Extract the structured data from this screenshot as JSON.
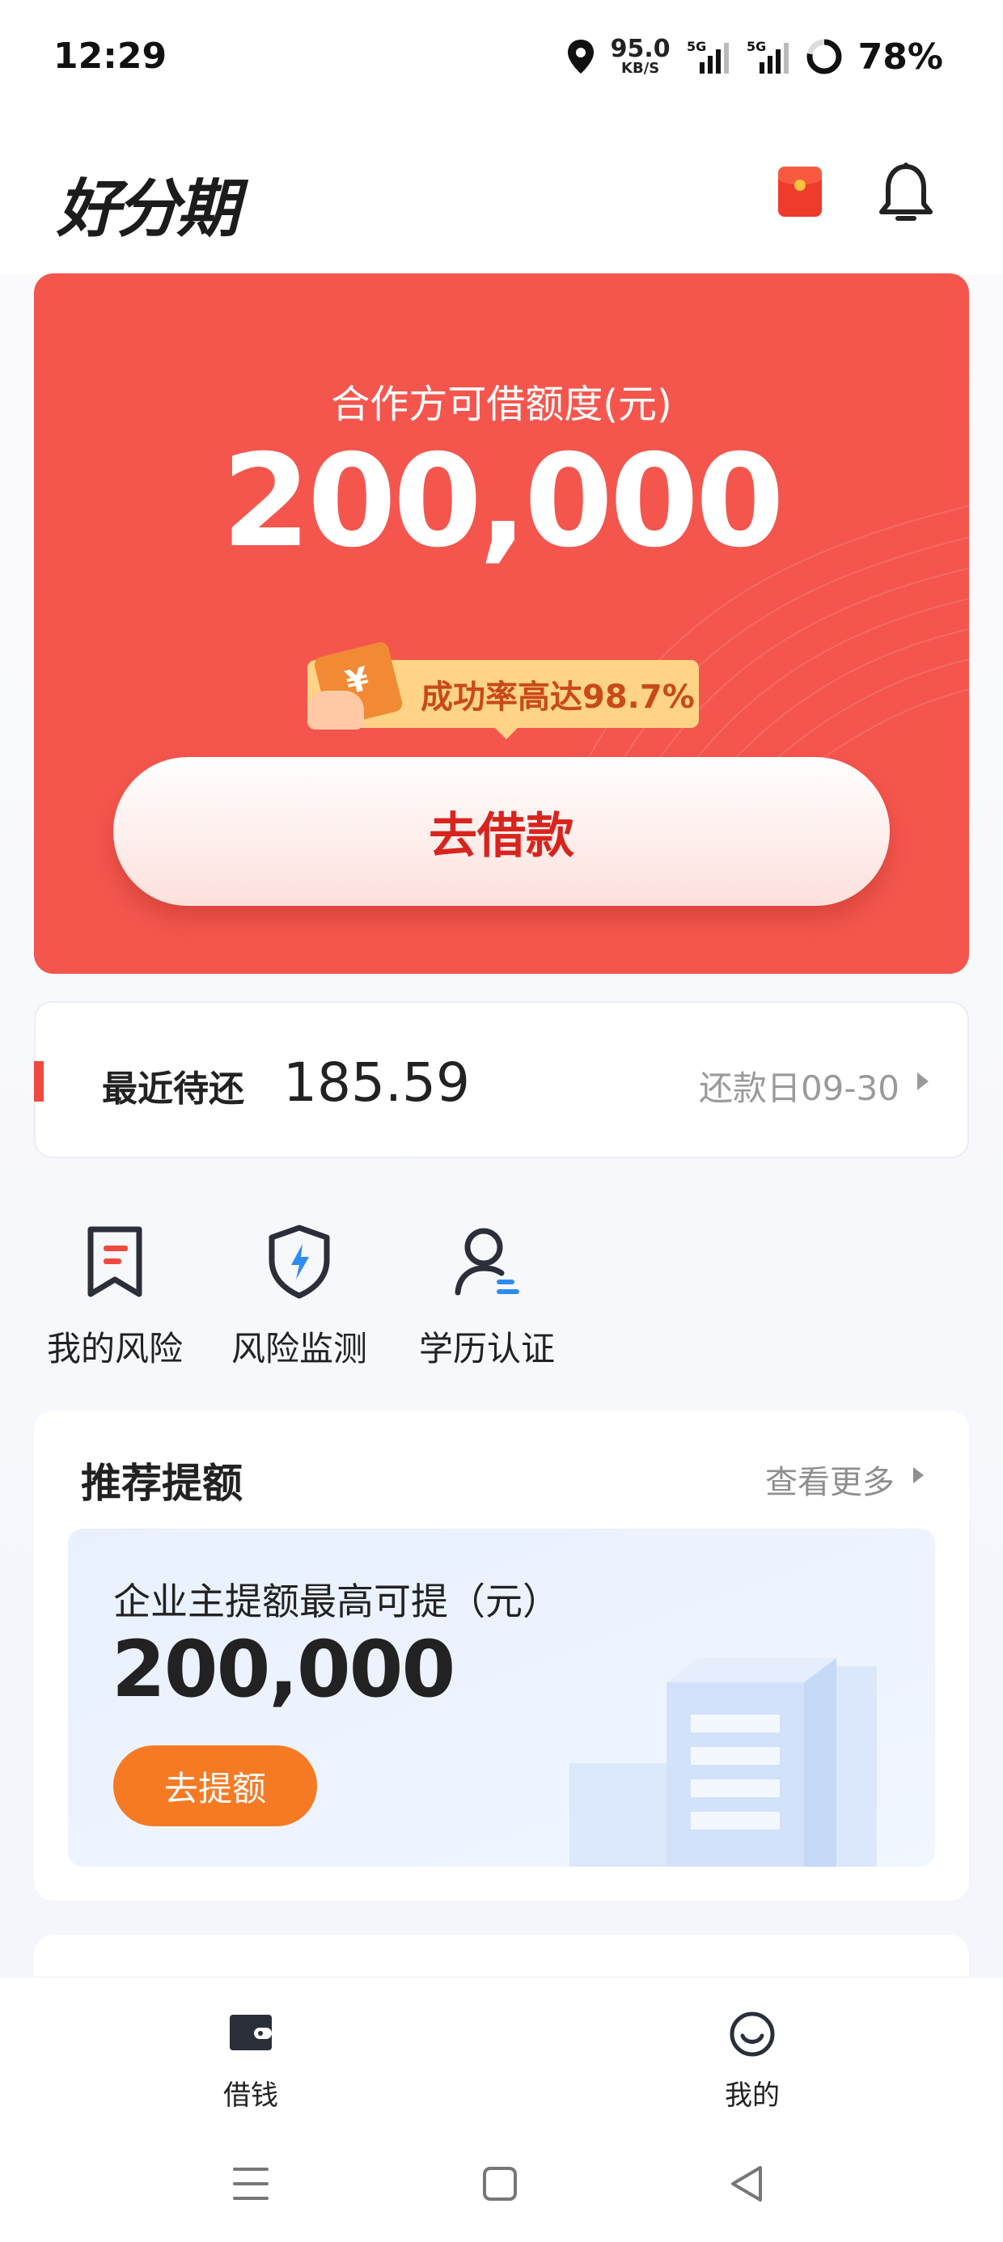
{
  "status_bar": {
    "time": "12:29",
    "net_speed": "95.0",
    "net_speed_unit": "KB/S",
    "signal_1": "5G",
    "signal_2": "5G",
    "battery": "78%"
  },
  "header": {
    "logo": "好分期",
    "redpacket_icon": "red-envelope-icon",
    "bell_icon": "bell-icon"
  },
  "credit": {
    "label": "合作方可借额度(元)",
    "amount": "200,000",
    "rate_ticket": "¥",
    "rate_text": "成功率高达98.7%",
    "borrow_button": "去借款",
    "colors": {
      "card": "#f4564d",
      "button_text": "#d8241d",
      "badge": "#ffd486"
    }
  },
  "repayment": {
    "title": "最近待还",
    "amount": "185.59",
    "due": "还款日09-30"
  },
  "quick_actions": [
    {
      "label": "我的风险",
      "icon": "bookmark-icon"
    },
    {
      "label": "风险监测",
      "icon": "shield-bolt-icon"
    },
    {
      "label": "学历认证",
      "icon": "user-id-icon"
    }
  ],
  "recommend": {
    "title": "推荐提额",
    "more": "查看更多",
    "subtitle": "企业主提额最高可提（元）",
    "amount": "200,000",
    "button": "去提额",
    "colors": {
      "button": "#f57a23"
    }
  },
  "tabbar": [
    {
      "label": "借钱",
      "icon": "wallet-icon",
      "active": true
    },
    {
      "label": "我的",
      "icon": "smiley-icon",
      "active": false
    }
  ],
  "nav": {
    "menu_icon": "menu-icon",
    "home_icon": "square-home-icon",
    "back_icon": "triangle-back-icon"
  }
}
